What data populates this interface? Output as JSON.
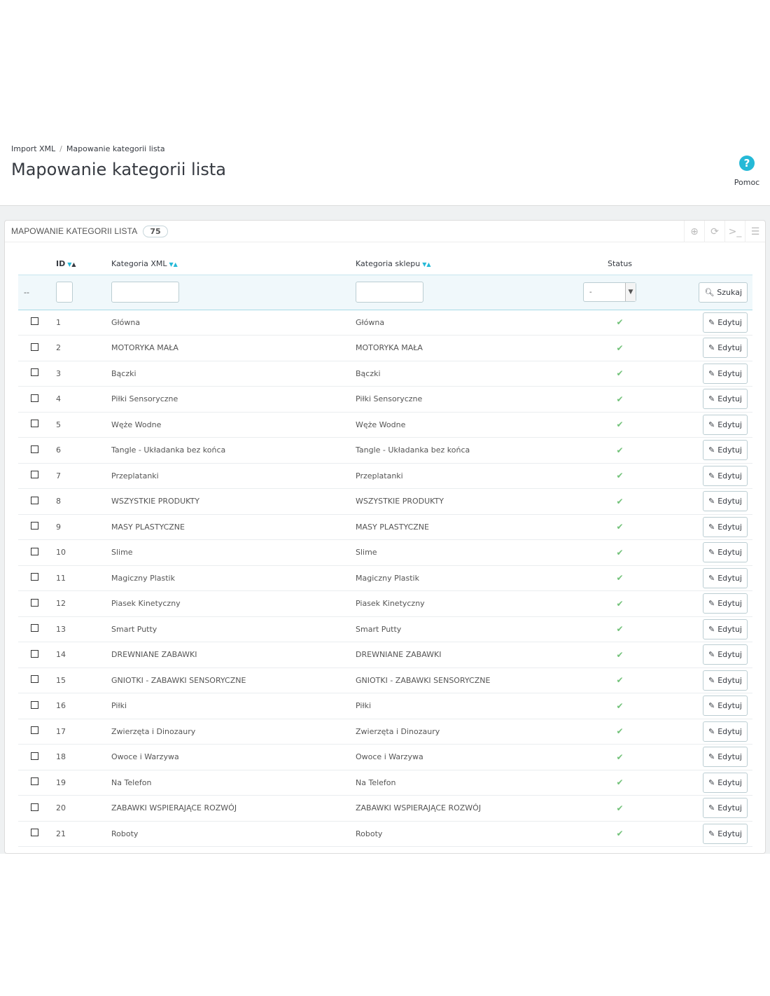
{
  "breadcrumb": {
    "parent": "Import XML",
    "separator": "/",
    "current": "Mapowanie kategorii lista"
  },
  "page_title": "Mapowanie kategorii lista",
  "help": {
    "label": "Pomoc",
    "glyph": "?"
  },
  "panel": {
    "title": "MAPOWANIE KATEGORII LISTA",
    "count": "75"
  },
  "table": {
    "headers": {
      "id": "ID",
      "xml": "Kategoria XML",
      "shop": "Kategoria sklepu",
      "status": "Status"
    },
    "filter": {
      "bulk": "--",
      "status_value": "-",
      "search_label": "Szukaj"
    },
    "edit_label": "Edytuj",
    "rows": [
      {
        "id": "1",
        "xml": "Główna",
        "shop": "Główna"
      },
      {
        "id": "2",
        "xml": "MOTORYKA MAŁA",
        "shop": "MOTORYKA MAŁA"
      },
      {
        "id": "3",
        "xml": "Bączki",
        "shop": "Bączki"
      },
      {
        "id": "4",
        "xml": "Piłki Sensoryczne",
        "shop": "Piłki Sensoryczne"
      },
      {
        "id": "5",
        "xml": "Węże Wodne",
        "shop": "Węże Wodne"
      },
      {
        "id": "6",
        "xml": "Tangle - Układanka bez końca",
        "shop": "Tangle - Układanka bez końca"
      },
      {
        "id": "7",
        "xml": "Przeplatanki",
        "shop": "Przeplatanki"
      },
      {
        "id": "8",
        "xml": "WSZYSTKIE PRODUKTY",
        "shop": "WSZYSTKIE PRODUKTY"
      },
      {
        "id": "9",
        "xml": "MASY PLASTYCZNE",
        "shop": "MASY PLASTYCZNE"
      },
      {
        "id": "10",
        "xml": "Slime",
        "shop": "Slime"
      },
      {
        "id": "11",
        "xml": "Magiczny Plastik",
        "shop": "Magiczny Plastik"
      },
      {
        "id": "12",
        "xml": "Piasek Kinetyczny",
        "shop": "Piasek Kinetyczny"
      },
      {
        "id": "13",
        "xml": "Smart Putty",
        "shop": "Smart Putty"
      },
      {
        "id": "14",
        "xml": "DREWNIANE ZABAWKI",
        "shop": "DREWNIANE ZABAWKI"
      },
      {
        "id": "15",
        "xml": "GNIOTKI - ZABAWKI SENSORYCZNE",
        "shop": "GNIOTKI - ZABAWKI SENSORYCZNE"
      },
      {
        "id": "16",
        "xml": "Piłki",
        "shop": "Piłki"
      },
      {
        "id": "17",
        "xml": "Zwierzęta i Dinozaury",
        "shop": "Zwierzęta i Dinozaury"
      },
      {
        "id": "18",
        "xml": "Owoce i Warzywa",
        "shop": "Owoce i Warzywa"
      },
      {
        "id": "19",
        "xml": "Na Telefon",
        "shop": "Na Telefon"
      },
      {
        "id": "20",
        "xml": "ZABAWKI WSPIERAJĄCE ROZWÓJ",
        "shop": "ZABAWKI WSPIERAJĄCE ROZWÓJ"
      },
      {
        "id": "21",
        "xml": "Roboty",
        "shop": "Roboty"
      }
    ]
  },
  "colors": {
    "accent": "#25b9d7",
    "check": "#72c279",
    "text": "#363a41"
  }
}
